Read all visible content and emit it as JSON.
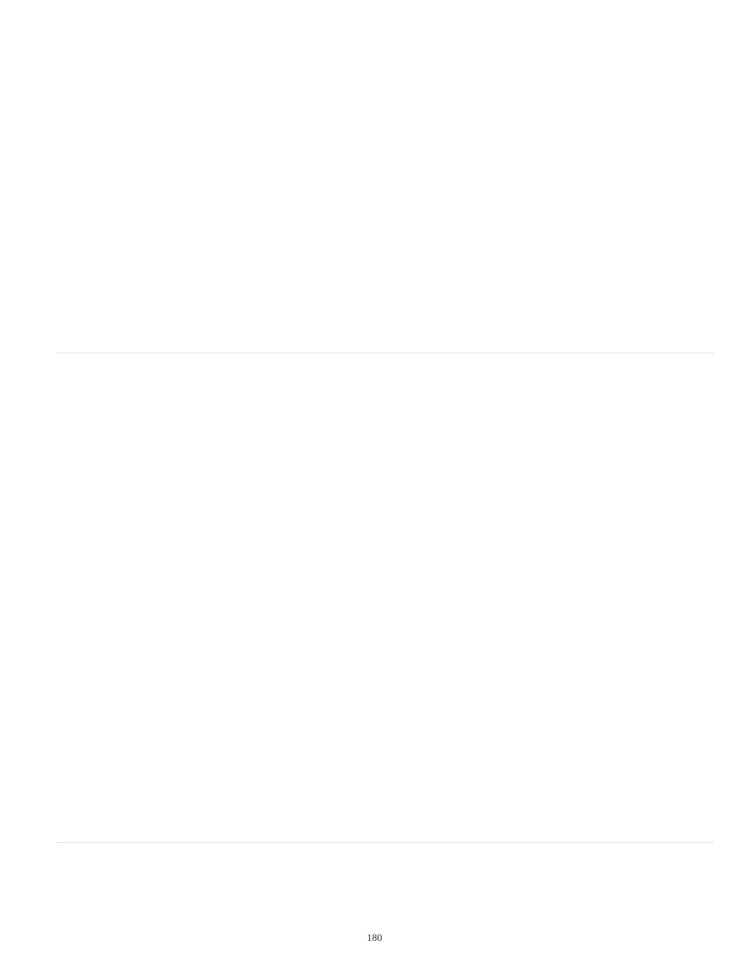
{
  "page_number": "180"
}
